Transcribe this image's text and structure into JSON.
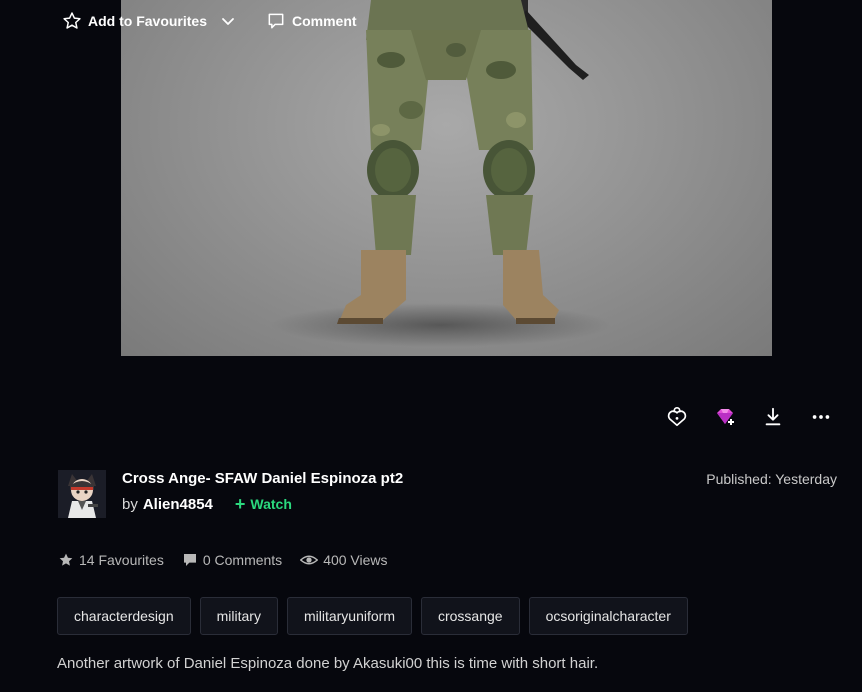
{
  "actions": {
    "favourite_label": "Add to Favourites",
    "comment_label": "Comment"
  },
  "deviation": {
    "title": "Cross Ange- SFAW Daniel Espinoza pt2",
    "by_prefix": "by",
    "author": "Alien4854",
    "watch_label": "Watch",
    "published": "Published: Yesterday"
  },
  "stats": {
    "favourites": "14 Favourites",
    "comments": "0 Comments",
    "views": "400 Views"
  },
  "tags": [
    "characterdesign",
    "military",
    "militaryuniform",
    "crossange",
    "ocsoriginalcharacter"
  ],
  "description": "Another artwork of Daniel Espinoza done by Akasuki00 this is time with short hair.",
  "colors": {
    "background": "#06070d",
    "watch_accent": "#2bd97e",
    "gem_accent": "#e04bd8"
  },
  "icons": [
    "star-icon",
    "chevron-down-icon",
    "comment-icon",
    "heart-lock-icon",
    "gem-plus-icon",
    "download-icon",
    "more-icon",
    "eye-icon"
  ]
}
